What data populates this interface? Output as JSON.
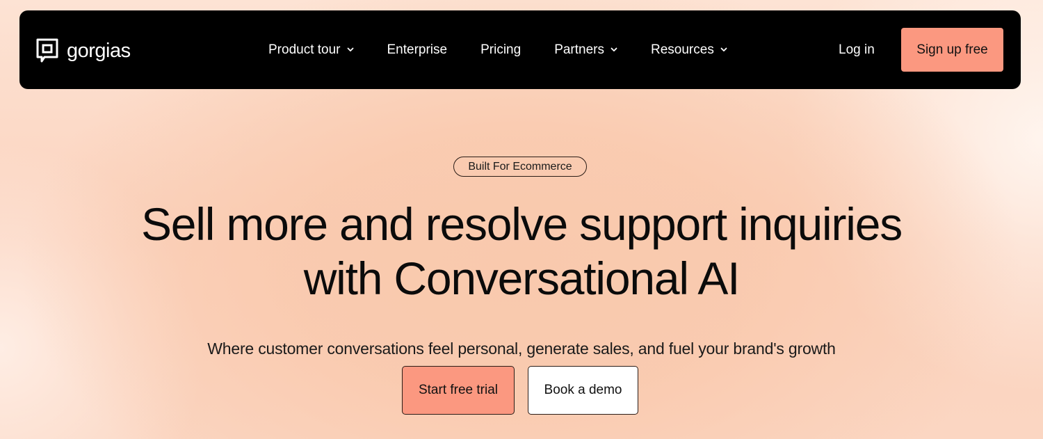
{
  "nav": {
    "logo_text": "gorgias",
    "logo_icon": "gorgias-logo-icon",
    "items": [
      {
        "label": "Product tour",
        "has_dropdown": true
      },
      {
        "label": "Enterprise",
        "has_dropdown": false
      },
      {
        "label": "Pricing",
        "has_dropdown": false
      },
      {
        "label": "Partners",
        "has_dropdown": true
      },
      {
        "label": "Resources",
        "has_dropdown": true
      }
    ],
    "login_label": "Log in",
    "signup_label": "Sign up free"
  },
  "hero": {
    "badge": "Built For Ecommerce",
    "headline_line1": "Sell more and resolve support inquiries",
    "headline_line2": "with Conversational AI",
    "subtitle": "Where customer conversations feel personal, generate sales, and fuel your brand's growth",
    "primary_cta": "Start free trial",
    "secondary_cta": "Book a demo"
  },
  "colors": {
    "nav_background": "#000000",
    "accent": "#fb9880",
    "page_background": "#fbd2bd",
    "text": "#0b0b0b"
  }
}
